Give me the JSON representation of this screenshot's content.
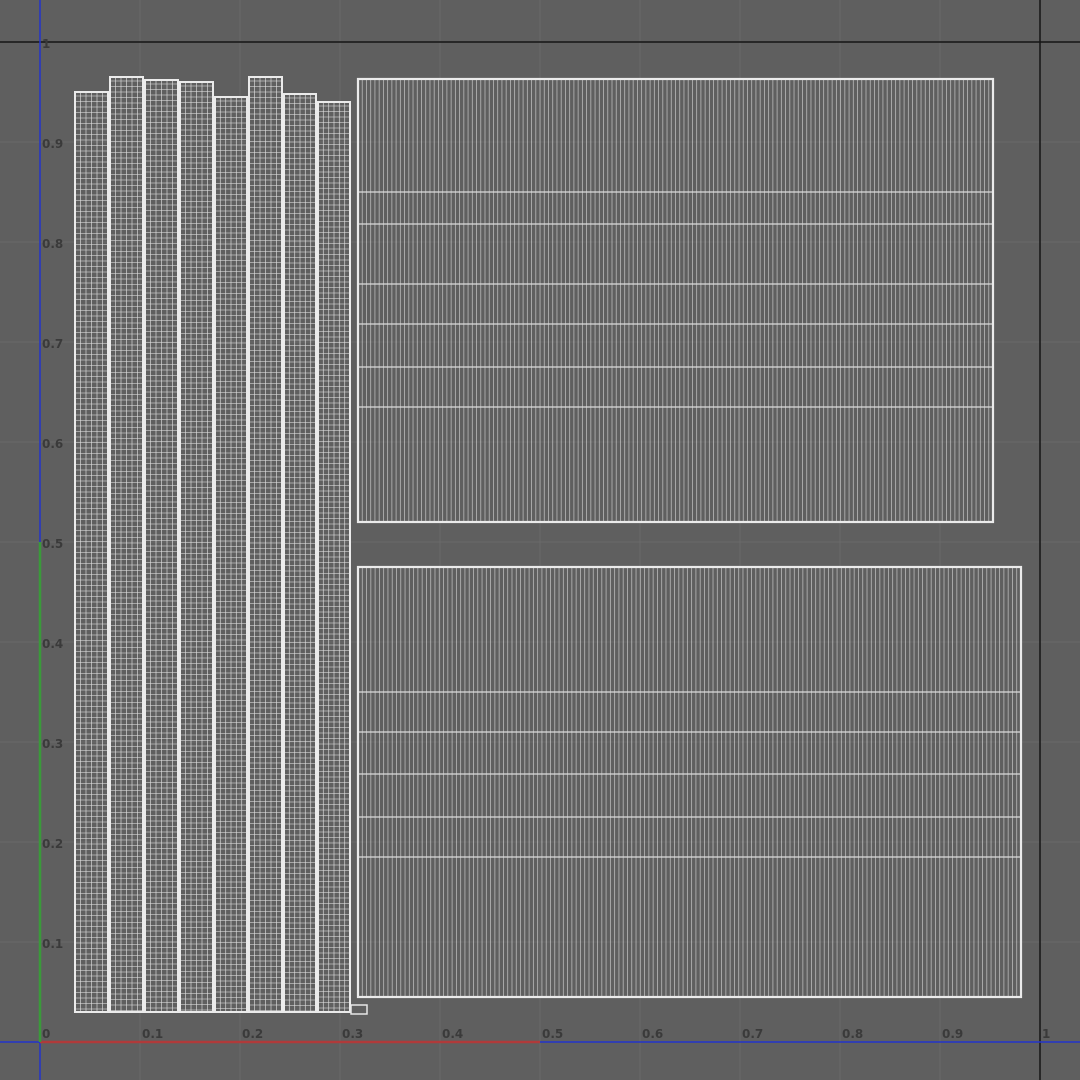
{
  "viewport": {
    "name": "uv-editor",
    "x_range": [
      0,
      1
    ],
    "y_range": [
      0,
      1
    ],
    "grid_step": 0.1,
    "colors": {
      "background": "#5f5f5f",
      "grid": "#6a6a6a",
      "unit_bound": "#151515",
      "mesh": "#e0e0e0",
      "u_axis": "#b03a3a",
      "v_axis": "#3a9a3a",
      "frame_axis": "#2233cc",
      "tick_text": "#3a3a3a"
    }
  },
  "axis_labels": {
    "u": [
      "0",
      "0.1",
      "0.2",
      "0.3",
      "0.4",
      "0.5",
      "0.6",
      "0.7",
      "0.8",
      "0.9",
      "1"
    ],
    "v": [
      "0.1",
      "0.2",
      "0.3",
      "0.4",
      "0.5",
      "0.6",
      "0.7",
      "0.8",
      "0.9",
      "1"
    ]
  },
  "uv_islands": {
    "strips": [
      {
        "u0": 0.035,
        "u1": 0.068,
        "v0": 0.03,
        "v1": 0.95
      },
      {
        "u0": 0.07,
        "u1": 0.103,
        "v0": 0.03,
        "v1": 0.965
      },
      {
        "u0": 0.105,
        "u1": 0.138,
        "v0": 0.03,
        "v1": 0.962
      },
      {
        "u0": 0.14,
        "u1": 0.173,
        "v0": 0.03,
        "v1": 0.96
      },
      {
        "u0": 0.175,
        "u1": 0.207,
        "v0": 0.03,
        "v1": 0.945
      },
      {
        "u0": 0.209,
        "u1": 0.242,
        "v0": 0.03,
        "v1": 0.965
      },
      {
        "u0": 0.244,
        "u1": 0.276,
        "v0": 0.03,
        "v1": 0.948
      },
      {
        "u0": 0.278,
        "u1": 0.31,
        "v0": 0.03,
        "v1": 0.94
      }
    ],
    "panels": [
      {
        "u0": 0.318,
        "u1": 0.953,
        "v0": 0.52,
        "v1": 0.963,
        "rows": [
          0.635,
          0.675,
          0.718,
          0.758,
          0.818,
          0.85
        ],
        "cols": 150
      },
      {
        "u0": 0.318,
        "u1": 0.981,
        "v0": 0.045,
        "v1": 0.475,
        "rows": [
          0.185,
          0.225,
          0.268,
          0.31,
          0.35
        ],
        "cols": 155
      }
    ]
  }
}
